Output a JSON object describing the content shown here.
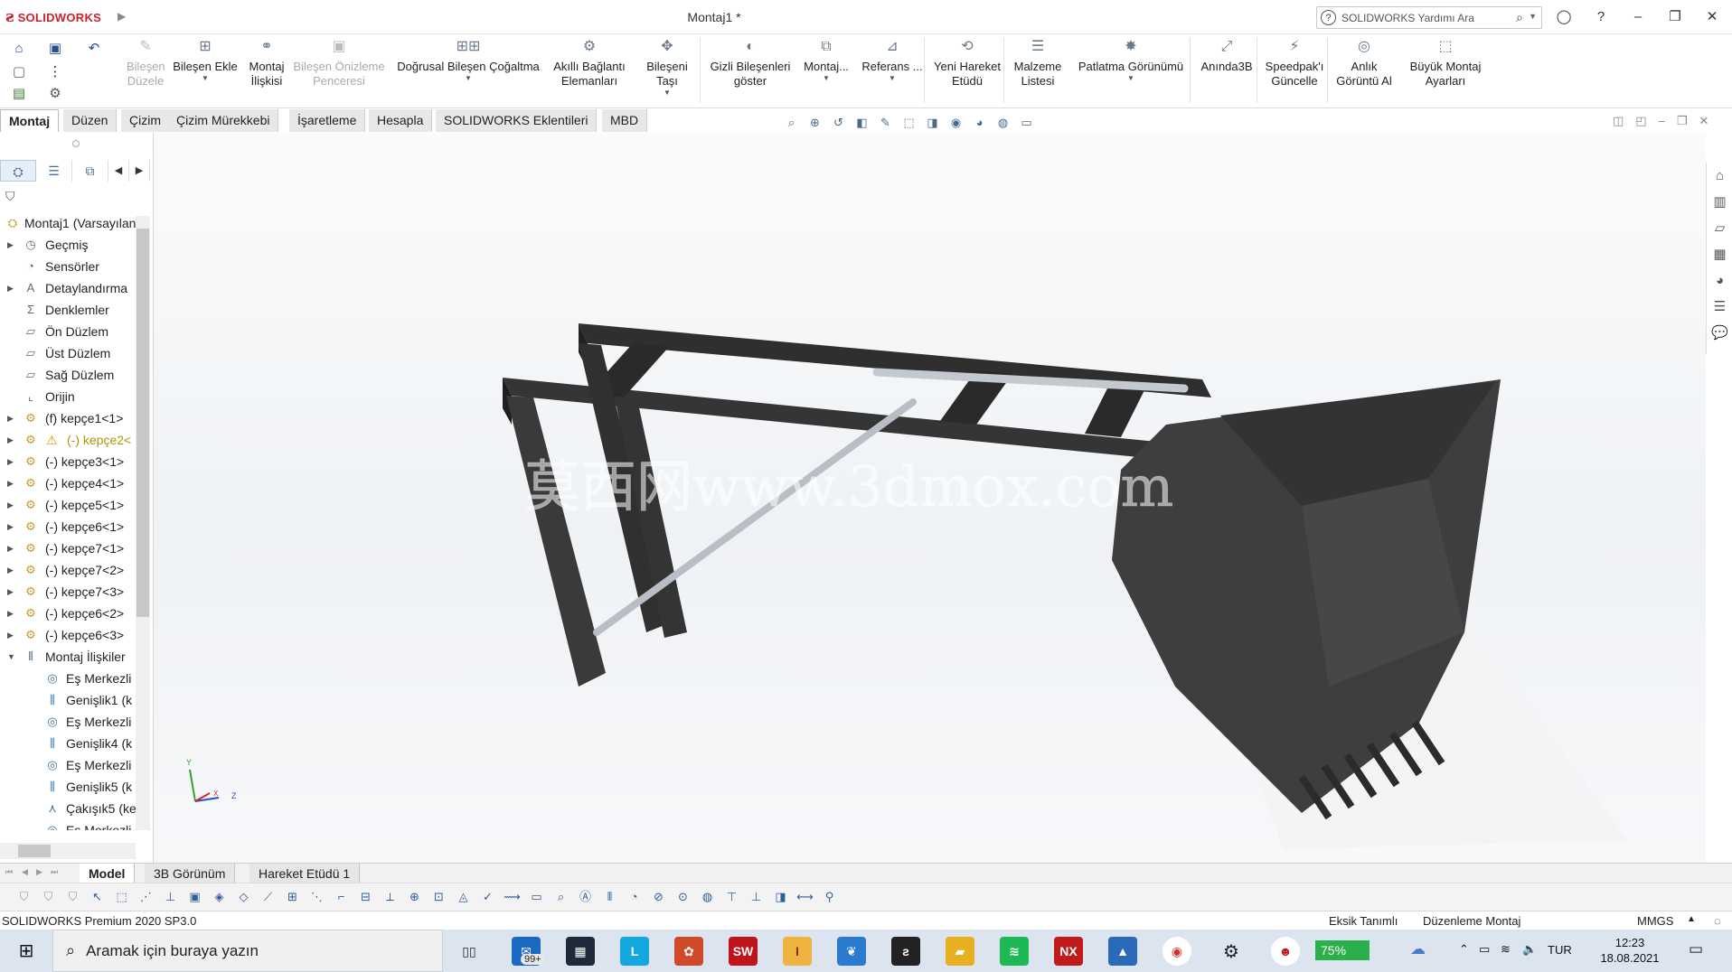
{
  "titlebar": {
    "app_name": "SOLIDWORKS",
    "document_title": "Montaj1 *",
    "search_placeholder": "SOLIDWORKS Yardımı Ara",
    "minimize": "–",
    "restore": "❐",
    "close": "✕"
  },
  "commands": [
    {
      "label": "Bileşen\nDüzele",
      "icon": "edit-component-icon",
      "enabled": false
    },
    {
      "label": "Bileşen Ekle",
      "icon": "insert-component-icon",
      "enabled": true,
      "dropdown": true
    },
    {
      "label": "Montaj\nİlişkisi",
      "icon": "mate-icon",
      "enabled": true
    },
    {
      "label": "Bileşen Önizleme\nPenceresi",
      "icon": "component-preview-icon",
      "enabled": false
    },
    {
      "label": "Doğrusal Bileşen Çoğaltma",
      "icon": "linear-pattern-icon",
      "enabled": true,
      "dropdown": true
    },
    {
      "label": "Akıllı Bağlantı\nElemanları",
      "icon": "smart-fasteners-icon",
      "enabled": true
    },
    {
      "label": "Bileşeni Taşı",
      "icon": "move-component-icon",
      "enabled": true,
      "dropdown": true
    },
    {
      "label": "Gizli Bileşenleri\ngöster",
      "icon": "show-hidden-icon",
      "enabled": true
    },
    {
      "label": "Montaj...",
      "icon": "assembly-features-icon",
      "enabled": true,
      "dropdown": true
    },
    {
      "label": "Referans ...",
      "icon": "reference-geometry-icon",
      "enabled": true,
      "dropdown": true
    },
    {
      "label": "Yeni Hareket\nEtüdü",
      "icon": "motion-study-icon",
      "enabled": true
    },
    {
      "label": "Malzeme\nListesi",
      "icon": "bom-icon",
      "enabled": true
    },
    {
      "label": "Patlatma Görünümü",
      "icon": "exploded-view-icon",
      "enabled": true,
      "dropdown": true
    },
    {
      "label": "Anında3B",
      "icon": "instant3d-icon",
      "enabled": true
    },
    {
      "label": "Speedpak'ı\nGüncelle",
      "icon": "speedpak-icon",
      "enabled": true
    },
    {
      "label": "Anlık\nGörüntü Al",
      "icon": "snapshot-icon",
      "enabled": true
    },
    {
      "label": "Büyük Montaj\nAyarları",
      "icon": "large-assembly-icon",
      "enabled": true
    }
  ],
  "tabs": [
    "Montaj",
    "Düzen",
    "Çizim",
    "Çizim Mürekkebi",
    "İşaretleme",
    "Hesapla",
    "SOLIDWORKS Eklentileri",
    "MBD"
  ],
  "active_tab": "Montaj",
  "tree": {
    "root": "Montaj1  (Varsayılan",
    "items": [
      {
        "label": "Geçmiş",
        "icon": "history-icon",
        "expandable": true
      },
      {
        "label": "Sensörler",
        "icon": "sensor-icon",
        "expandable": false
      },
      {
        "label": "Detaylandırma",
        "icon": "annotations-icon",
        "expandable": true
      },
      {
        "label": "Denklemler",
        "icon": "equations-icon",
        "expandable": false
      },
      {
        "label": "Ön Düzlem",
        "icon": "plane-icon",
        "expandable": false
      },
      {
        "label": "Üst Düzlem",
        "icon": "plane-icon",
        "expandable": false
      },
      {
        "label": "Sağ Düzlem",
        "icon": "plane-icon",
        "expandable": false
      },
      {
        "label": "Orijin",
        "icon": "origin-icon",
        "expandable": false
      },
      {
        "label": "(f) kepçe1<1>",
        "icon": "part-icon",
        "expandable": true,
        "comp": true
      },
      {
        "label": "(-) kepçe2<",
        "icon": "part-icon",
        "expandable": true,
        "comp": true,
        "warning": true
      },
      {
        "label": "(-) kepçe3<1>",
        "icon": "part-icon",
        "expandable": true,
        "comp": true
      },
      {
        "label": "(-) kepçe4<1>",
        "icon": "part-icon",
        "expandable": true,
        "comp": true
      },
      {
        "label": "(-) kepçe5<1>",
        "icon": "part-icon",
        "expandable": true,
        "comp": true
      },
      {
        "label": "(-) kepçe6<1>",
        "icon": "part-icon",
        "expandable": true,
        "comp": true
      },
      {
        "label": "(-) kepçe7<1>",
        "icon": "part-icon",
        "expandable": true,
        "comp": true
      },
      {
        "label": "(-) kepçe7<2>",
        "icon": "part-icon",
        "expandable": true,
        "comp": true
      },
      {
        "label": "(-) kepçe7<3>",
        "icon": "part-icon",
        "expandable": true,
        "comp": true
      },
      {
        "label": "(-) kepçe6<2>",
        "icon": "part-icon",
        "expandable": true,
        "comp": true
      },
      {
        "label": "(-) kepçe6<3>",
        "icon": "part-icon",
        "expandable": true,
        "comp": true
      },
      {
        "label": "Montaj İlişkiler",
        "icon": "mates-folder-icon",
        "expandable": true,
        "expanded": true
      },
      {
        "label": "Eş Merkezli",
        "icon": "concentric-icon",
        "child": true
      },
      {
        "label": "Genişlik1 (k",
        "icon": "width-mate-icon",
        "child": true
      },
      {
        "label": "Eş Merkezli",
        "icon": "concentric-icon",
        "child": true
      },
      {
        "label": "Genişlik4 (k",
        "icon": "width-mate-icon",
        "child": true
      },
      {
        "label": "Eş Merkezli",
        "icon": "concentric-icon",
        "child": true
      },
      {
        "label": "Genişlik5 (k",
        "icon": "width-mate-icon",
        "child": true
      },
      {
        "label": "Çakışık5 (ke",
        "icon": "coincident-icon",
        "child": true
      },
      {
        "label": "Eş Merkezli",
        "icon": "concentric-icon",
        "child": true
      }
    ]
  },
  "viewport": {
    "watermark": "莫西网www.3dmox.com",
    "triad": {
      "x": "X",
      "y": "Y",
      "z": "Z"
    }
  },
  "bottom_tabs": [
    "Model",
    "3B Görünüm",
    "Hareket Etüdü 1"
  ],
  "active_bottom_tab": "Model",
  "status": {
    "product": "SOLIDWORKS Premium 2020 SP3.0",
    "defined": "Eksik Tanımlı",
    "mode": "Düzenleme Montaj",
    "units": "MMGS"
  },
  "taskbar": {
    "search_placeholder": "Aramak için buraya yazın",
    "mail_badge": "99+",
    "battery": "75%",
    "language": "TUR",
    "time": "12:23",
    "date": "18.08.2021"
  },
  "colors": {
    "brand": "#d11f2a",
    "model_dark": "#3b3b3b",
    "cylinder": "#b7bcc4"
  }
}
